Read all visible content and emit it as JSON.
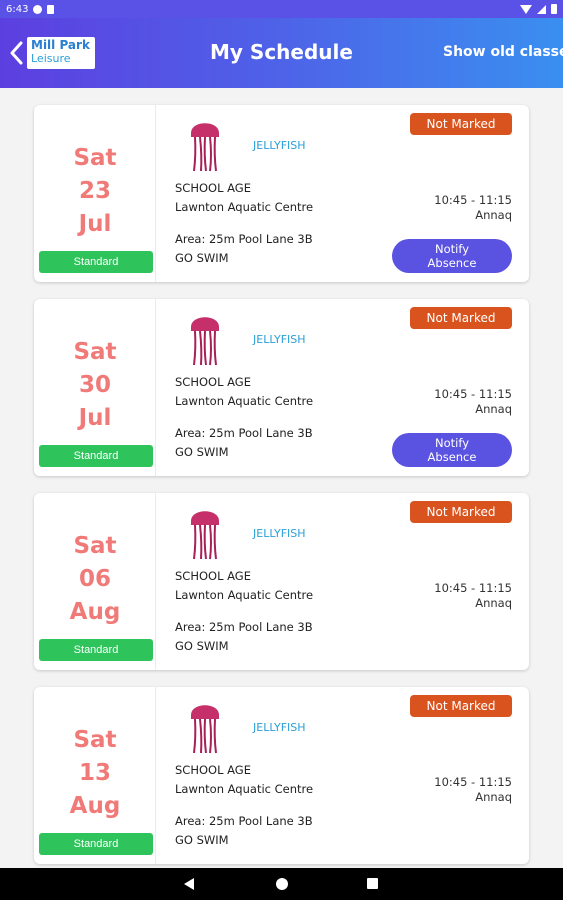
{
  "status_bar": {
    "time": "6:43"
  },
  "header": {
    "logo_line1": "Mill Park",
    "logo_line2": "Leisure",
    "title": "My Schedule",
    "show_old_label": "Show old classes"
  },
  "classes": [
    {
      "day": "Sat",
      "date": "23",
      "month": "Jul",
      "badge": "Standard",
      "class_name": "JELLYFISH",
      "age_group": "SCHOOL AGE",
      "location": "Lawnton Aquatic Centre",
      "area": "Area: 25m Pool Lane 3B",
      "program": "GO SWIM",
      "status": "Not Marked",
      "time": "10:45 - 11:15",
      "instructor": "Annaq",
      "notify_line1": "Notify",
      "notify_line2": "Absence"
    },
    {
      "day": "Sat",
      "date": "30",
      "month": "Jul",
      "badge": "Standard",
      "class_name": "JELLYFISH",
      "age_group": "SCHOOL AGE",
      "location": "Lawnton Aquatic Centre",
      "area": "Area: 25m Pool Lane 3B",
      "program": "GO SWIM",
      "status": "Not Marked",
      "time": "10:45 - 11:15",
      "instructor": "Annaq",
      "notify_line1": "Notify",
      "notify_line2": "Absence"
    },
    {
      "day": "Sat",
      "date": "06",
      "month": "Aug",
      "badge": "Standard",
      "class_name": "JELLYFISH",
      "age_group": "SCHOOL AGE",
      "location": "Lawnton Aquatic Centre",
      "area": "Area: 25m Pool Lane 3B",
      "program": "GO SWIM",
      "status": "Not Marked",
      "time": "10:45 - 11:15",
      "instructor": "Annaq"
    },
    {
      "day": "Sat",
      "date": "13",
      "month": "Aug",
      "badge": "Standard",
      "class_name": "JELLYFISH",
      "age_group": "SCHOOL AGE",
      "location": "Lawnton Aquatic Centre",
      "area": "Area: 25m Pool Lane 3B",
      "program": "GO SWIM",
      "status": "Not Marked",
      "time": "10:45 - 11:15",
      "instructor": "Annaq"
    }
  ],
  "colors": {
    "date_text": "#f07a78",
    "badge": "#2ec45b",
    "status_pill": "#d9531e",
    "notify_button": "#5a52e0",
    "class_name": "#2a9fd8"
  }
}
